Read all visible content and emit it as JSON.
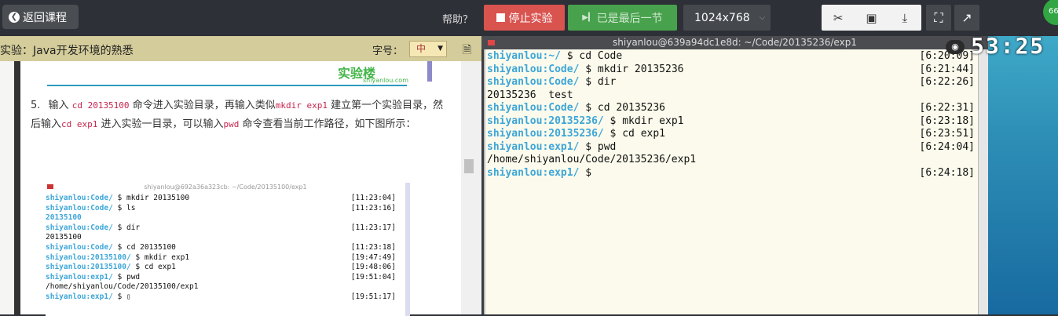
{
  "topbar": {
    "back_label": "返回课程",
    "help_label": "帮助？",
    "stop_label": "停止实验",
    "last_label": "已是最后一节",
    "resolution": "1024x768",
    "badge": "66"
  },
  "doc": {
    "title": "实验：Java开发环境的熟悉",
    "font_label": "字号：",
    "font_value": "中",
    "logo_text": "实验楼",
    "logo_sub": "shiyanlou.com",
    "step_num": "5.",
    "step_parts": {
      "t1": "输入",
      "c1": "cd 20135100",
      "t2": "命令进入实验目录，再输入类似",
      "c2": "mkdir exp1",
      "t3": "建立第一个实验目录，然后输入",
      "c3": "cd exp1",
      "t4": "进入实验一目录，可以输入",
      "c4": "pwd",
      "t5": "命令查看当前工作路径，如下图所示："
    },
    "screenshot": {
      "title": "shiyanlou@692a36a323cb: ~/Code/20135100/exp1",
      "lines": [
        {
          "user": "shiyanlou",
          "path": ":Code/",
          "cmd": " $ mkdir 20135100",
          "ts": "[11:23:04]"
        },
        {
          "user": "shiyanlou",
          "path": ":Code/",
          "cmd": " $ ls",
          "ts": "[11:23:16]"
        },
        {
          "plain": "20135100",
          "blue": true
        },
        {
          "user": "shiyanlou",
          "path": ":Code/",
          "cmd": " $ dir",
          "ts": "[11:23:17]"
        },
        {
          "plain": "20135100"
        },
        {
          "user": "shiyanlou",
          "path": ":Code/",
          "cmd": " $ cd 20135100",
          "ts": "[11:23:18]"
        },
        {
          "user": "shiyanlou",
          "path": ":20135100/",
          "cmd": " $ mkdir exp1",
          "ts": "[19:47:49]"
        },
        {
          "user": "shiyanlou",
          "path": ":20135100/",
          "cmd": " $ cd exp1",
          "ts": "[19:48:06]"
        },
        {
          "user": "shiyanlou",
          "path": ":exp1/",
          "cmd": " $ pwd",
          "ts": "[19:51:04]"
        },
        {
          "plain": "/home/shiyanlou/Code/20135100/exp1"
        },
        {
          "user": "shiyanlou",
          "path": ":exp1/",
          "cmd": " $ ▯",
          "ts": "[19:51:17]"
        }
      ]
    }
  },
  "terminal": {
    "title": "shiyanlou@639a94dc1e8d: ~/Code/20135236/exp1",
    "lines": [
      {
        "user": "shiyanlou",
        "path": ":~/",
        "cmd": " $ cd Code",
        "ts": "[6:20:09]"
      },
      {
        "user": "shiyanlou",
        "path": ":Code/",
        "cmd": " $ mkdir 20135236",
        "ts": "[6:21:44]"
      },
      {
        "user": "shiyanlou",
        "path": ":Code/",
        "cmd": " $ dir",
        "ts": "[6:22:26]"
      },
      {
        "plain": "20135236  test"
      },
      {
        "user": "shiyanlou",
        "path": ":Code/",
        "cmd": " $ cd 20135236",
        "ts": "[6:22:31]"
      },
      {
        "user": "shiyanlou",
        "path": ":20135236/",
        "cmd": " $ mkdir exp1",
        "ts": "[6:23:18]"
      },
      {
        "user": "shiyanlou",
        "path": ":20135236/",
        "cmd": " $ cd exp1",
        "ts": "[6:23:51]"
      },
      {
        "user": "shiyanlou",
        "path": ":exp1/",
        "cmd": " $ pwd",
        "ts": "[6:24:04]"
      },
      {
        "plain": "/home/shiyanlou/Code/20135236/exp1"
      },
      {
        "user": "shiyanlou",
        "path": ":exp1/",
        "cmd": " $",
        "ts": "[6:24:18]"
      }
    ]
  },
  "timer": "53:25"
}
